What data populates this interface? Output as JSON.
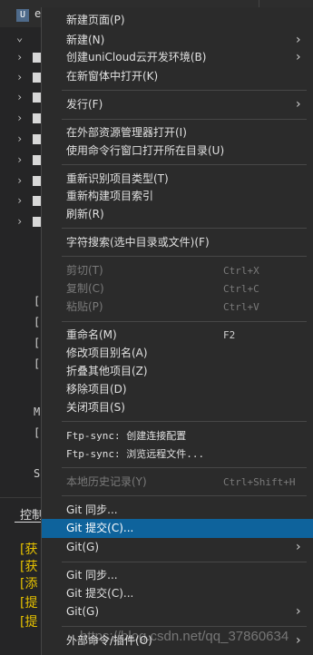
{
  "editor": {
    "tab_letter": "U",
    "tab_text": "e",
    "tree_glyphs": [
      "[",
      "[",
      "[",
      "[",
      "M",
      "[",
      "S"
    ],
    "console_tab": "控制",
    "console_lines": [
      "[获",
      "[获",
      "[添",
      "[提",
      "[提"
    ]
  },
  "menu": {
    "items": [
      {
        "label": "新建页面(P)"
      },
      {
        "label": "新建(N)",
        "arrow": "›"
      },
      {
        "label": "创建uniCloud云开发环境(B)",
        "arrow": "›"
      },
      {
        "label": "在新窗体中打开(K)"
      },
      {
        "label": "发行(F)",
        "arrow": "›"
      },
      {
        "label": "在外部资源管理器打开(I)"
      },
      {
        "label": "使用命令行窗口打开所在目录(U)"
      },
      {
        "label": "重新识别项目类型(T)"
      },
      {
        "label": "重新构建项目索引"
      },
      {
        "label": "刷新(R)"
      },
      {
        "label": "字符搜索(选中目录或文件)(F)"
      },
      {
        "label": "剪切(T)",
        "shortcut": "Ctrl+X"
      },
      {
        "label": "复制(C)",
        "shortcut": "Ctrl+C"
      },
      {
        "label": "粘贴(P)",
        "shortcut": "Ctrl+V"
      },
      {
        "label": "重命名(M)",
        "shortcut": "F2"
      },
      {
        "label": "修改项目别名(A)"
      },
      {
        "label": "折叠其他项目(Z)"
      },
      {
        "label": "移除项目(D)"
      },
      {
        "label": "关闭项目(S)"
      },
      {
        "label": "Ftp-sync: 创建连接配置"
      },
      {
        "label": "Ftp-sync: 浏览远程文件..."
      },
      {
        "label": "本地历史记录(Y)",
        "shortcut": "Ctrl+Shift+H"
      },
      {
        "label": "Git 同步..."
      },
      {
        "label": "Git 提交(C)..."
      },
      {
        "label": "Git(G)",
        "arrow": "›"
      },
      {
        "label": "Git 同步..."
      },
      {
        "label": "Git 提交(C)..."
      },
      {
        "label": "Git(G)",
        "arrow": "›"
      },
      {
        "label": "外部命令/插件(O)",
        "arrow": "›"
      }
    ]
  },
  "watermark": "https://blog.csdn.net/qq_37860634",
  "colors": {
    "menu_bg": "#2b2b2b",
    "highlight": "#0e639c",
    "console_text": "#e6c200"
  }
}
